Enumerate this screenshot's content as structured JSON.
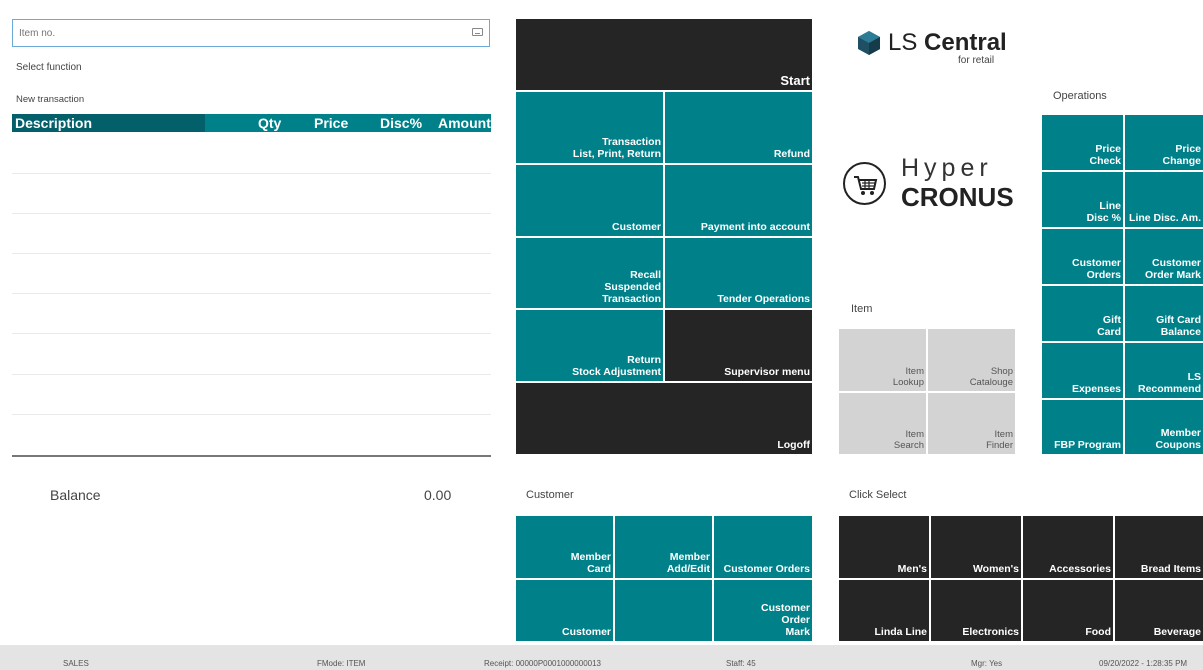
{
  "item_input": {
    "placeholder": "Item no."
  },
  "labels": {
    "select_function": "Select function",
    "new_transaction": "New transaction"
  },
  "table": {
    "columns": [
      "Description",
      "Qty",
      "Price",
      "Disc%",
      "Amount"
    ]
  },
  "balance": {
    "label": "Balance",
    "value": "0.00"
  },
  "main_menu": {
    "start": "Start",
    "transaction_list": "Transaction\nList, Print, Return",
    "refund": "Refund",
    "customer": "Customer",
    "payment_into_account": "Payment into account",
    "recall_suspended": "Recall\nSuspended\nTransaction",
    "tender_operations": "Tender Operations",
    "return_stock": "Return\nStock Adjustment",
    "supervisor_menu": "Supervisor menu",
    "logoff": "Logoff"
  },
  "customer_section": {
    "label": "Customer",
    "member_card": "Member\nCard",
    "member_add_edit": "Member\nAdd/Edit",
    "customer_orders": "Customer Orders",
    "customer": "Customer",
    "customer_order_mark": "Customer\nOrder\nMark"
  },
  "logo": {
    "ls_prefix": "LS ",
    "ls_brand": "Central",
    "ls_sub": "for retail",
    "hyper": "Hyper",
    "cronus": "CRONUS"
  },
  "item_section": {
    "label": "Item",
    "item_lookup": "Item\nLookup",
    "shop_catalouge": "Shop\nCatalouge",
    "item_search": "Item\nSearch",
    "item_finder": "Item\nFinder"
  },
  "operations": {
    "label": "Operations",
    "price_check": "Price\nCheck",
    "price_change": "Price\nChange",
    "line_disc_pct": "Line\nDisc %",
    "line_disc_am": "Line Disc. Am.",
    "customer_orders": "Customer\nOrders",
    "customer_order_mark": "Customer\nOrder Mark",
    "gift_card": "Gift\nCard",
    "gift_card_balance": "Gift Card\nBalance",
    "expenses": "Expenses",
    "ls_recommend": "LS\nRecommend",
    "fbp_program": "FBP Program",
    "member_coupons": "Member\nCoupons"
  },
  "click_select": {
    "label": "Click Select",
    "items": [
      "Men's",
      "Women's",
      "Accessories",
      "Bread Items",
      "Linda Line",
      "Electronics",
      "Food",
      "Beverage"
    ]
  },
  "status_bar": {
    "mode": "SALES",
    "fmode": "FMode: ITEM",
    "receipt": "Receipt: 00000P0001000000013",
    "staff": "Staff: 45",
    "mgr": "Mgr: Yes",
    "datetime": "09/20/2022 - 1:28:35 PM"
  },
  "colors": {
    "teal": "#00818a",
    "dark_teal": "#03606a",
    "dark": "#252525",
    "grey_tile": "#d3d3d3",
    "status_bar": "#e4e4e4"
  }
}
